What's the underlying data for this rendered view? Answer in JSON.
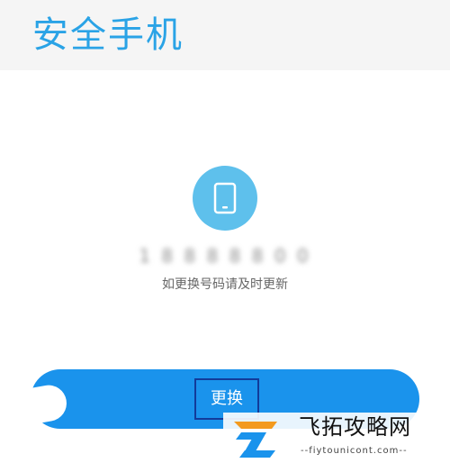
{
  "header": {
    "title": "安全手机"
  },
  "phone": {
    "icon": "phone-icon",
    "number_masked": "1 8 8 8 8 8 0 0",
    "hint": "如更换号码请及时更新"
  },
  "actions": {
    "change_label": "更换"
  },
  "watermark": {
    "title": "飞拓攻略网",
    "domain": "--fiytounicont.com--"
  },
  "colors": {
    "accent": "#2aa3e6",
    "button": "#1a93ec",
    "icon_circle": "#5ec0ec",
    "header_bg": "#f5f5f5"
  }
}
